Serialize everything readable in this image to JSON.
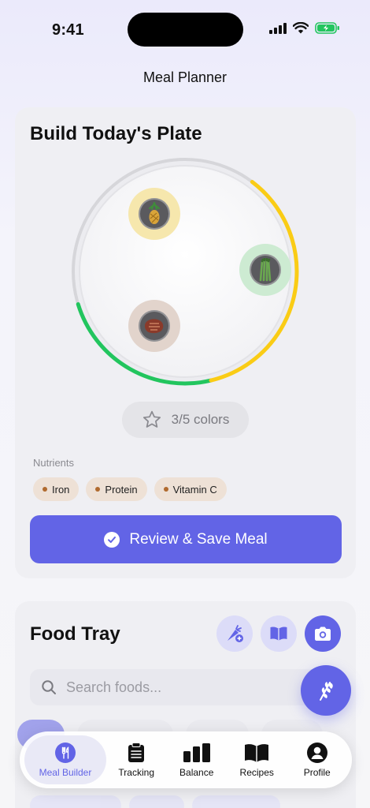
{
  "status": {
    "time": "9:41"
  },
  "nav": {
    "title": "Meal Planner"
  },
  "plate_card": {
    "title": "Build Today's Plate",
    "colors_progress": "3/5 colors",
    "ring_progress": 0.6,
    "nutrients_label": "Nutrients",
    "nutrients": [
      "Iron",
      "Protein",
      "Vitamin C"
    ],
    "save_label": "Review & Save Meal",
    "foods": [
      "Pineapple",
      "Asparagus",
      "Beef"
    ]
  },
  "tray": {
    "title": "Food Tray",
    "search_placeholder": "Search foods..."
  },
  "tabs": [
    {
      "label": "Meal Builder",
      "icon": "fork-knife-icon",
      "active": true
    },
    {
      "label": "Tracking",
      "icon": "clipboard-icon"
    },
    {
      "label": "Balance",
      "icon": "bar-chart-icon"
    },
    {
      "label": "Recipes",
      "icon": "book-icon"
    },
    {
      "label": "Profile",
      "icon": "person-icon"
    }
  ],
  "colors": {
    "accent": "#6264E6",
    "green": "#22C55E",
    "yellow": "#FACC15"
  }
}
